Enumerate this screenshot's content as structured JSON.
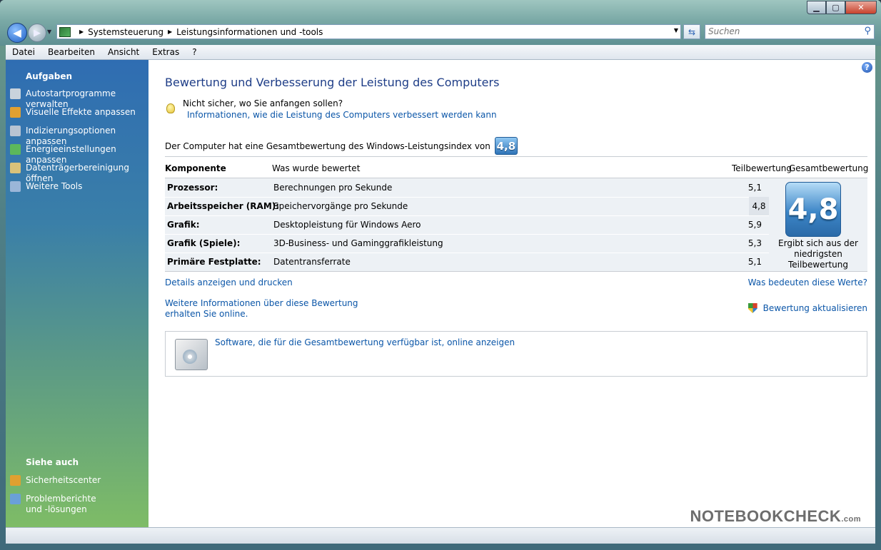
{
  "window": {
    "controls": {
      "minimize": "▁",
      "maximize": "▢",
      "close": "✕"
    }
  },
  "nav": {
    "back_icon": "◀",
    "forward_icon": "▶"
  },
  "address": {
    "crumb1": "Systemsteuerung",
    "crumb2": "Leistungsinformationen und -tools"
  },
  "search": {
    "placeholder": "Suchen"
  },
  "menu": [
    "Datei",
    "Bearbeiten",
    "Ansicht",
    "Extras",
    "?"
  ],
  "sidebar": {
    "tasks_heading": "Aufgaben",
    "tasks": [
      {
        "label": "Autostartprogramme verwalten",
        "icon": "startup-programs-icon",
        "color": "#c9d3dc"
      },
      {
        "label": "Visuelle Effekte anpassen",
        "icon": "shield-icon",
        "color": "#e0a030"
      },
      {
        "label": "Indizierungsoptionen anpassen",
        "icon": "indexing-icon",
        "color": "#b8c4d2"
      },
      {
        "label": "Energieeinstellungen anpassen",
        "icon": "power-icon",
        "color": "#5cb85c"
      },
      {
        "label": "Datenträgerbereinigung öffnen",
        "icon": "disk-cleanup-icon",
        "color": "#d9c27a"
      },
      {
        "label": "Weitere Tools",
        "icon": "tools-icon",
        "color": "#9ab6d8"
      }
    ],
    "see_also_heading": "Siehe auch",
    "see_also": [
      {
        "label": "Sicherheitscenter",
        "icon": "security-center-icon",
        "color": "#e0a030"
      },
      {
        "label": "Problemberichte und -lösungen",
        "icon": "problem-reports-icon",
        "color": "#6aa0d8"
      }
    ]
  },
  "content": {
    "title": "Bewertung und Verbesserung der Leistung des Computers",
    "tip_question": "Nicht sicher, wo Sie anfangen sollen?",
    "tip_link": "Informationen, wie die Leistung des Computers verbessert werden kann",
    "overall_text": "Der Computer hat eine Gesamtbewertung des Windows-Leistungsindex von",
    "overall_score": "4,8",
    "table": {
      "headers": {
        "component": "Komponente",
        "rated": "Was wurde bewertet",
        "subscore": "Teilbewertung",
        "basescore": "Gesamtbewertung"
      },
      "rows": [
        {
          "component": "Prozessor:",
          "rated": "Berechnungen pro Sekunde",
          "subscore": "5,1"
        },
        {
          "component": "Arbeitsspeicher (RAM):",
          "rated": "Speichervorgänge pro Sekunde",
          "subscore": "4,8"
        },
        {
          "component": "Grafik:",
          "rated": "Desktopleistung für Windows Aero",
          "subscore": "5,9"
        },
        {
          "component": "Grafik (Spiele):",
          "rated": "3D-Business- und Gaminggrafikleistung",
          "subscore": "5,3"
        },
        {
          "component": "Primäre Festplatte:",
          "rated": "Datentransferrate",
          "subscore": "5,1"
        }
      ],
      "base_score": "4,8",
      "base_note": "Ergibt sich aus der niedrigsten Teilbewertung"
    },
    "link_details": "Details anzeigen und drucken",
    "link_meaning": "Was bedeuten diese Werte?",
    "link_more": "Weitere Informationen über diese Bewertung erhalten Sie online.",
    "link_update": "Bewertung aktualisieren",
    "link_software": "Software, die für die Gesamtbewertung verfügbar ist, online anzeigen"
  },
  "watermark": {
    "brand": "NOTEBOOKCHECK",
    "suffix": ".com"
  },
  "colors": {
    "link": "#0b56a8",
    "title": "#1e3d87",
    "score_badge": "#3d86c7"
  }
}
